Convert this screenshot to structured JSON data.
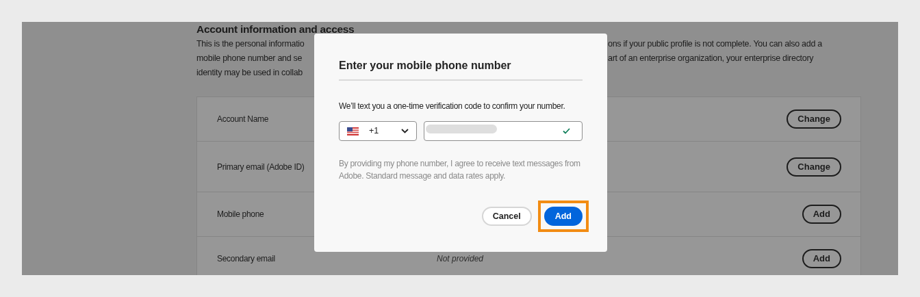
{
  "page": {
    "heading": "Account information and access",
    "intro_lines": [
      {
        "left": "This is the personal informatio",
        "right": "ons if your public profile is not complete. You can also add a"
      },
      {
        "left": "mobile phone number and se",
        "right": "art of an enterprise organization, your enterprise directory"
      },
      {
        "left": "identity may be used in collab"
      }
    ]
  },
  "rows": [
    {
      "label": "Account Name",
      "action": "Change"
    },
    {
      "label": "Primary email (Adobe ID)",
      "action": "Change"
    },
    {
      "label": "Mobile phone",
      "action": "Add"
    },
    {
      "label": "Secondary email",
      "value": "Not provided",
      "action": "Add"
    }
  ],
  "dialog": {
    "title": "Enter your mobile phone number",
    "message": "We’ll text you a one-time verification code to confirm your number.",
    "country_code": "+1",
    "phone_valid": true,
    "disclaimer": "By providing my phone number, I agree to receive text messages from Adobe. Standard message and data rates apply.",
    "buttons": [
      {
        "label": "Cancel",
        "kind": "secondary",
        "highlighted": false
      },
      {
        "label": "Add",
        "kind": "primary",
        "highlighted": true
      }
    ]
  }
}
